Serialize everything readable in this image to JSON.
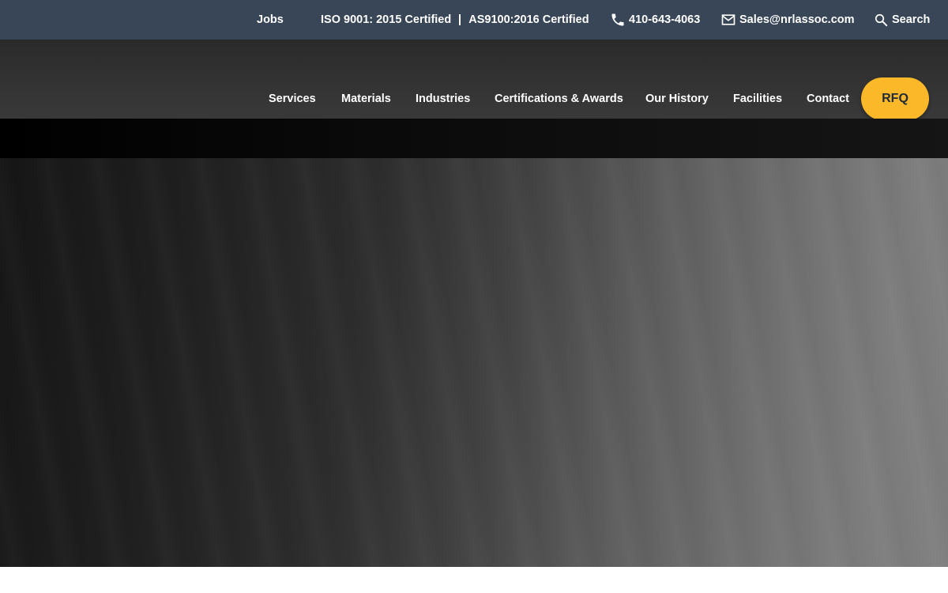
{
  "topbar": {
    "jobs": "Jobs",
    "cert_iso": "ISO 9001: 2015 Certified",
    "cert_as": "AS9100:2016 Certified",
    "phone": "410-643-4063",
    "email": "Sales@nrlassoc.com",
    "search": "Search",
    "icons": [
      "phone-icon",
      "mail-icon",
      "search-icon"
    ]
  },
  "nav": {
    "items": [
      {
        "label": "Services"
      },
      {
        "label": "Materials"
      },
      {
        "label": "Industries"
      },
      {
        "label": "Certifications & Awards"
      },
      {
        "label": "Our History"
      },
      {
        "label": "Facilities"
      },
      {
        "label": "Contact"
      }
    ],
    "rfq": "RFQ"
  },
  "colors": {
    "topbar_bg": "#384658",
    "nav_bg": "#333333",
    "rfq_bg": "#fbb829",
    "rfq_text": "#1f2a3a"
  }
}
